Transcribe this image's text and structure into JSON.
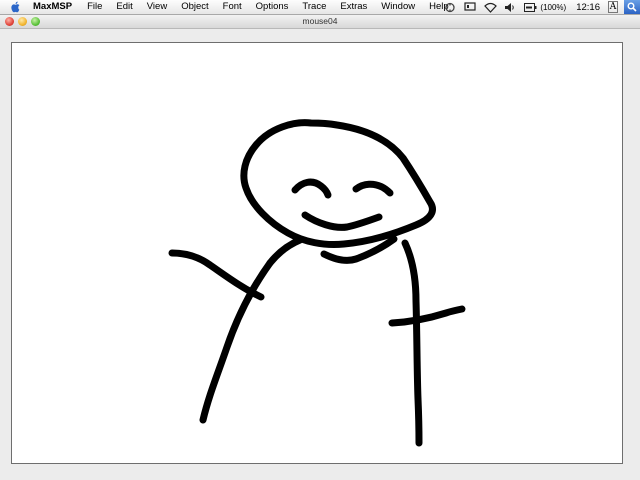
{
  "menubar": {
    "app_name": "MaxMSP",
    "menus": [
      "File",
      "Edit",
      "View",
      "Object",
      "Font",
      "Options",
      "Trace",
      "Extras",
      "Window",
      "Help"
    ],
    "battery": "(100%)",
    "clock": "12:16",
    "input_menu": "A"
  },
  "window": {
    "title": "mouse04"
  },
  "drawing": {
    "stroke_color": "#000000",
    "content": "stick-figure"
  }
}
